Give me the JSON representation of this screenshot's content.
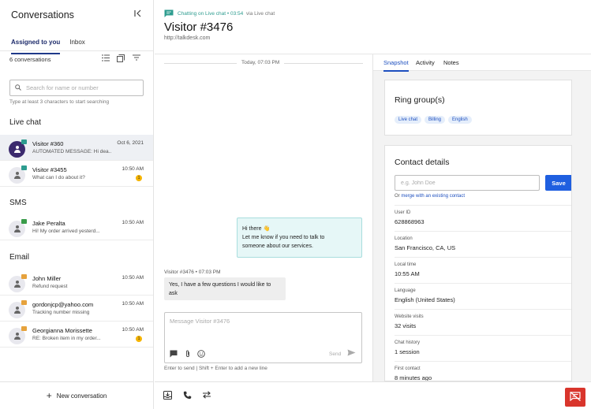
{
  "sidebar": {
    "title": "Conversations",
    "collapse_icon": "collapse-left-icon",
    "tabs": [
      {
        "label": "Assigned to you",
        "active": true
      },
      {
        "label": "Inbox",
        "active": false
      }
    ],
    "count_label": "6 conversations",
    "search": {
      "placeholder": "Search for name or number",
      "value": "",
      "hint": "Type at least 3 characters to start searching"
    },
    "sections": {
      "live_chat": "Live chat",
      "sms": "SMS",
      "email": "Email"
    },
    "items": [
      {
        "name": "Visitor #360",
        "preview": "AUTOMATED MESSAGE: Hi dea...",
        "time": "Oct 6, 2021",
        "channel": "chat",
        "badge": ""
      },
      {
        "name": "Visitor #3455",
        "preview": "What can I do about it?",
        "time": "10:50 AM",
        "channel": "chat",
        "badge": "1"
      },
      {
        "name": "Jake Peralta",
        "preview": "Hi! My order arrived yesterd...",
        "time": "10:50 AM",
        "channel": "sms",
        "badge": ""
      },
      {
        "name": "John Miller",
        "preview": "Refund request",
        "time": "10:50 AM",
        "channel": "mail",
        "badge": ""
      },
      {
        "name": "gordonjcp@yahoo.com",
        "preview": "Tracking number missing",
        "time": "10:50 AM",
        "channel": "mail",
        "badge": ""
      },
      {
        "name": "Georgianna Morissette",
        "preview": "RE: Broken item in my order...",
        "time": "10:50 AM",
        "channel": "mail",
        "badge": "1"
      }
    ],
    "new_conversation": "New conversation"
  },
  "header": {
    "status": "Chatting on Live chat • 03:54",
    "via": "via Live chat",
    "title": "Visitor #3476",
    "url": "http://talkdesk.com"
  },
  "conversation": {
    "day_label": "Today, 07:03 PM",
    "outgoing": {
      "line1": "Hi there 👋",
      "line2": "Let me know if you need to talk to",
      "line3": "someone about our services."
    },
    "incoming_meta": "Visitor #3476  •  07:03 PM",
    "incoming_text": "Yes, I have a few questions I would like to ask",
    "composer": {
      "placeholder": "Message Visitor #3476",
      "value": "",
      "send_label": "Send",
      "hint": "Enter to send | Shift + Enter to add a new line"
    }
  },
  "right_panel": {
    "tabs": [
      {
        "label": "Snapshot",
        "active": true
      },
      {
        "label": "Activity",
        "active": false
      },
      {
        "label": "Notes",
        "active": false
      }
    ],
    "ring_groups": {
      "title": "Ring group(s)",
      "chips": [
        "Live chat",
        "Billing",
        "English"
      ]
    },
    "contact": {
      "title": "Contact details",
      "name_placeholder": "e.g. John Doe",
      "name_value": "",
      "save_label": "Save",
      "merge_prefix": "Or",
      "merge_link": "merge with an existing contact",
      "fields": [
        {
          "label": "User ID",
          "value": "628868963"
        },
        {
          "label": "Location",
          "value": "San Francisco, CA, US"
        },
        {
          "label": "Local time",
          "value": "10:55 AM"
        },
        {
          "label": "Language",
          "value": "English (United States)"
        },
        {
          "label": "Website visits",
          "value": "32 visits"
        },
        {
          "label": "Chat history",
          "value": "1 session"
        },
        {
          "label": "First contact",
          "value": "8 minutes ago"
        }
      ]
    }
  },
  "footer": {
    "icons": [
      "transfer-inbox-icon",
      "phone-icon",
      "swap-icon",
      "end-chat-icon"
    ]
  },
  "colors": {
    "accent": "#1f5fe0",
    "teal": "#2d9c8f",
    "end_red": "#d9352c",
    "badge_yellow": "#f5b400"
  }
}
